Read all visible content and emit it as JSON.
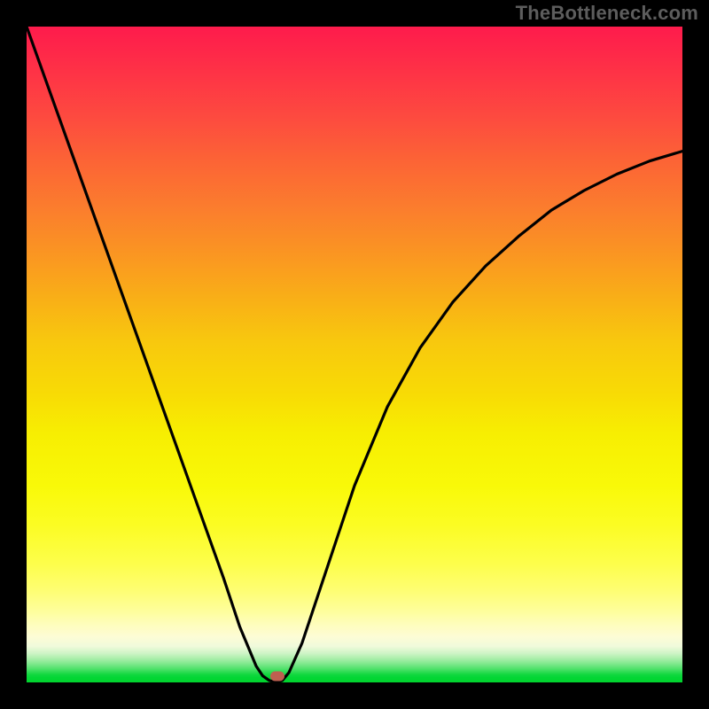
{
  "watermark": "TheBottleneck.com",
  "colors": {
    "background": "#000000",
    "curve": "#000000",
    "marker": "#be5f50",
    "gradient_top": "#fe1b4c",
    "gradient_mid": "#f8db05",
    "gradient_bottom": "#02d32e"
  },
  "chart_data": {
    "type": "line",
    "title": "",
    "xlabel": "",
    "ylabel": "",
    "xlim": [
      0,
      100
    ],
    "ylim": [
      0,
      100
    ],
    "x": [
      0,
      5,
      10,
      15,
      20,
      25,
      30,
      32.5,
      35,
      36,
      37,
      38,
      39,
      40,
      42,
      45,
      50,
      55,
      60,
      65,
      70,
      75,
      80,
      85,
      90,
      95,
      100
    ],
    "values": [
      100,
      86,
      72,
      58,
      44,
      30,
      16,
      8.5,
      2.5,
      1.0,
      0.3,
      0.0,
      0.3,
      1.5,
      6,
      15,
      30,
      42,
      51,
      58,
      63.5,
      68,
      72,
      75,
      77.5,
      79.5,
      81
    ],
    "minimum": {
      "x": 38,
      "y": 0
    }
  },
  "marker": {
    "x_pct": 38.3,
    "y_pct": 99.1
  }
}
